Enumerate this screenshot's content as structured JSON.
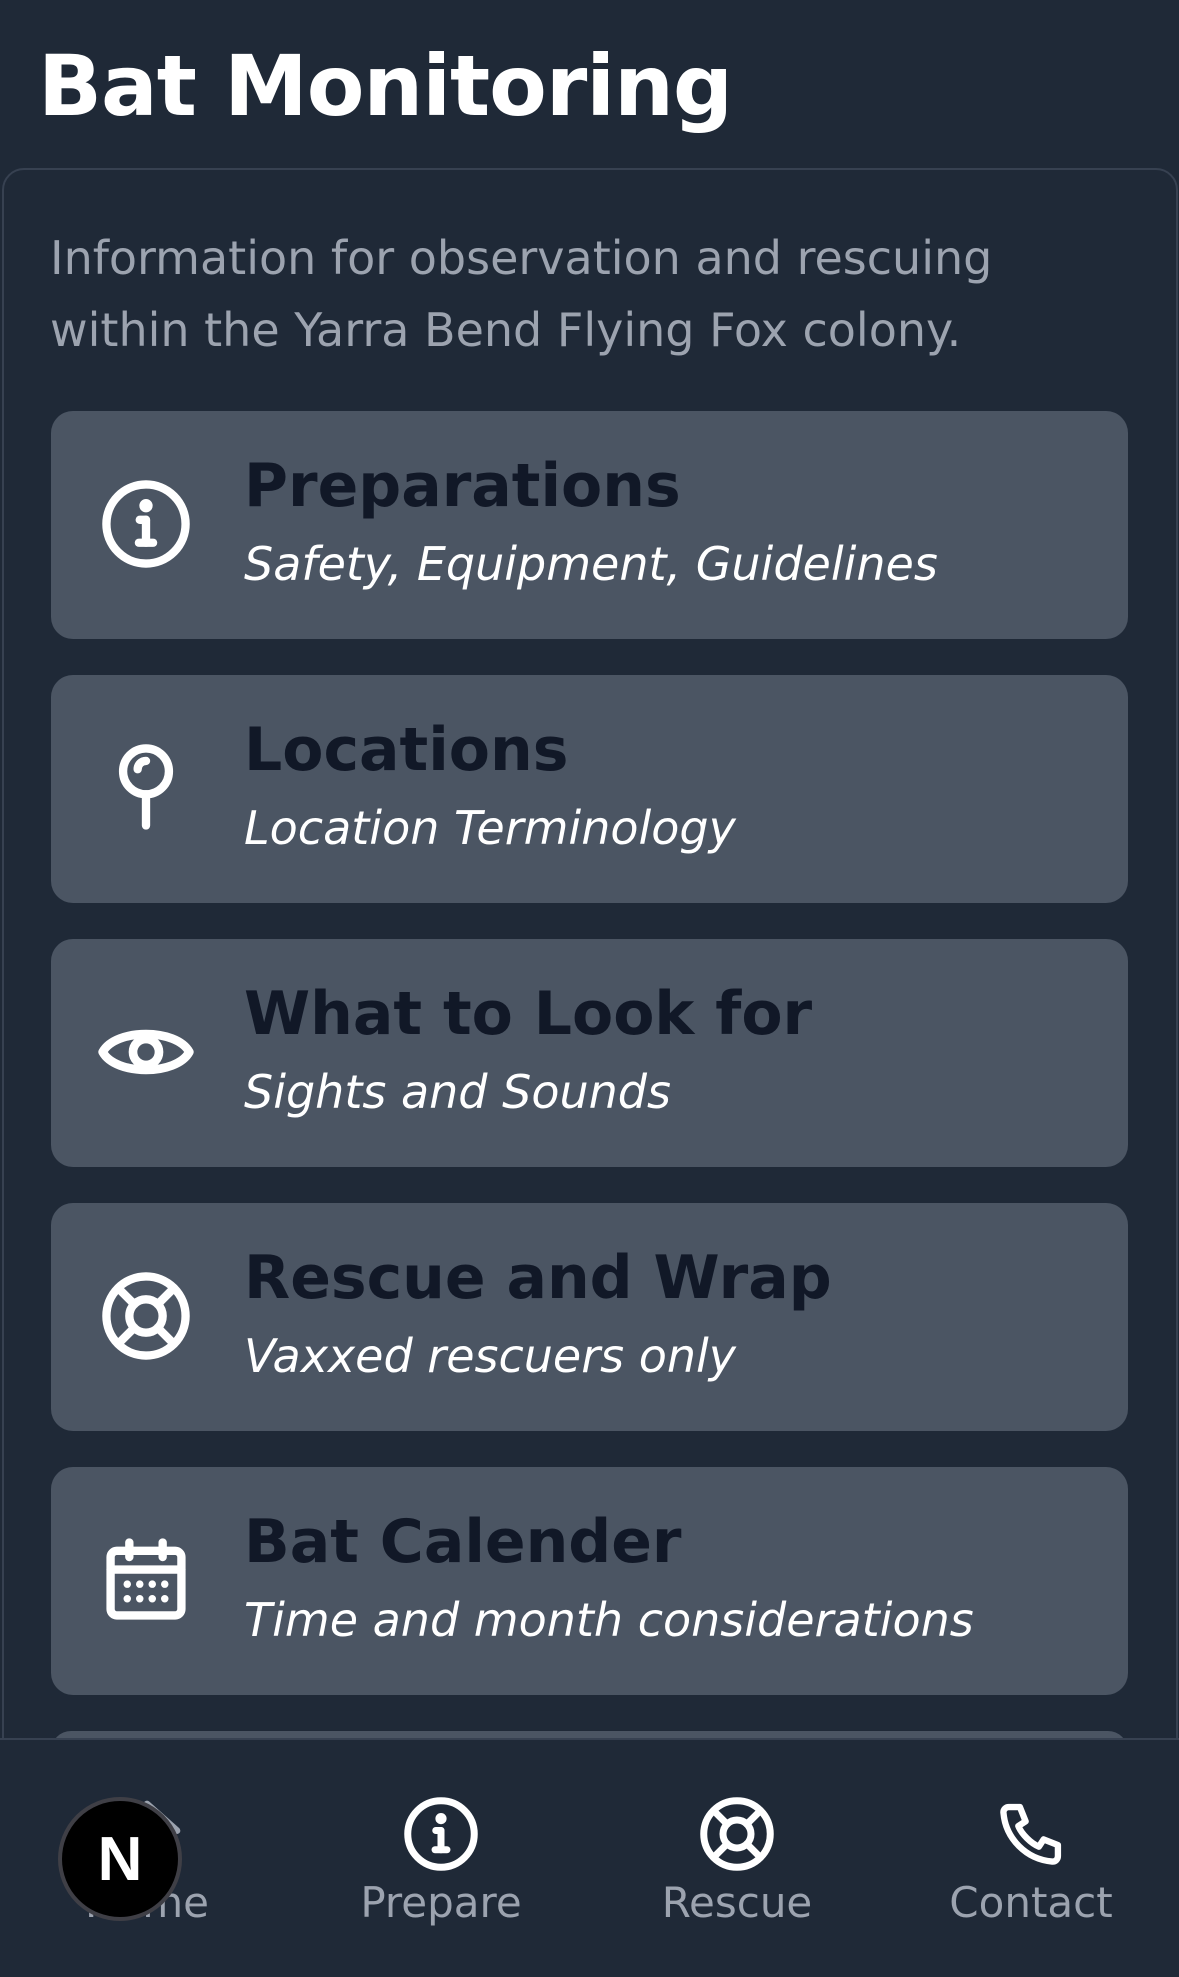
{
  "header": {
    "title": "Bat Monitoring"
  },
  "intro": "Information for observation and rescuing within the Yarra Bend Flying Fox colony.",
  "cards": [
    {
      "title": "Preparations",
      "subtitle": "Safety, Equipment, Guidelines",
      "icon": "info-icon"
    },
    {
      "title": "Locations",
      "subtitle": "Location Terminology",
      "icon": "map-pin-icon"
    },
    {
      "title": "What to Look for",
      "subtitle": "Sights and Sounds",
      "icon": "eye-icon"
    },
    {
      "title": "Rescue and Wrap",
      "subtitle": "Vaxxed rescuers only",
      "icon": "lifebuoy-icon"
    },
    {
      "title": "Bat Calender",
      "subtitle": "Time and month considerations",
      "icon": "calendar-icon"
    }
  ],
  "tabbar": [
    {
      "label": "Home",
      "icon": "home-icon"
    },
    {
      "label": "Prepare",
      "icon": "info-icon"
    },
    {
      "label": "Rescue",
      "icon": "lifebuoy-icon"
    },
    {
      "label": "Contact",
      "icon": "phone-icon"
    }
  ],
  "dev_badge": {
    "letter": "N"
  },
  "colors": {
    "background": "#1f2937",
    "card": "#4b5563",
    "card_title": "#111827",
    "muted_text": "#9ca3af"
  }
}
